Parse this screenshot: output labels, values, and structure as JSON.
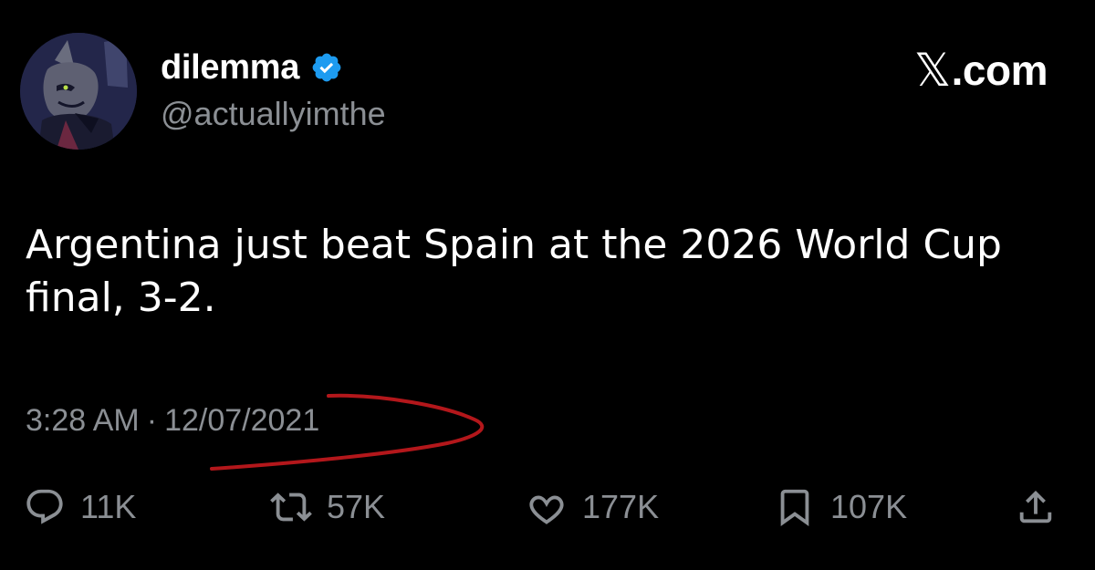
{
  "author": {
    "display_name": "dilemma",
    "handle": "@actuallyimthe",
    "verified": true,
    "verified_color": "#1d9bf0"
  },
  "brand": {
    "x_glyph": "𝕏",
    "suffix": ".com"
  },
  "tweet": {
    "text": "Argentina just beat Spain at the 2026 World Cup final, 3-2."
  },
  "timestamp": {
    "time": "3:28 AM",
    "separator": "·",
    "date": "12/07/2021",
    "annotation_color": "#b3171b"
  },
  "actions": {
    "reply": {
      "icon": "reply-icon",
      "count": "11K"
    },
    "repost": {
      "icon": "repost-icon",
      "count": "57K"
    },
    "like": {
      "icon": "heart-icon",
      "count": "177K"
    },
    "bookmark": {
      "icon": "bookmark-icon",
      "count": "107K"
    },
    "share": {
      "icon": "share-icon"
    }
  },
  "colors": {
    "background": "#000000",
    "primary_text": "#ffffff",
    "secondary_text": "#8b8f94"
  }
}
